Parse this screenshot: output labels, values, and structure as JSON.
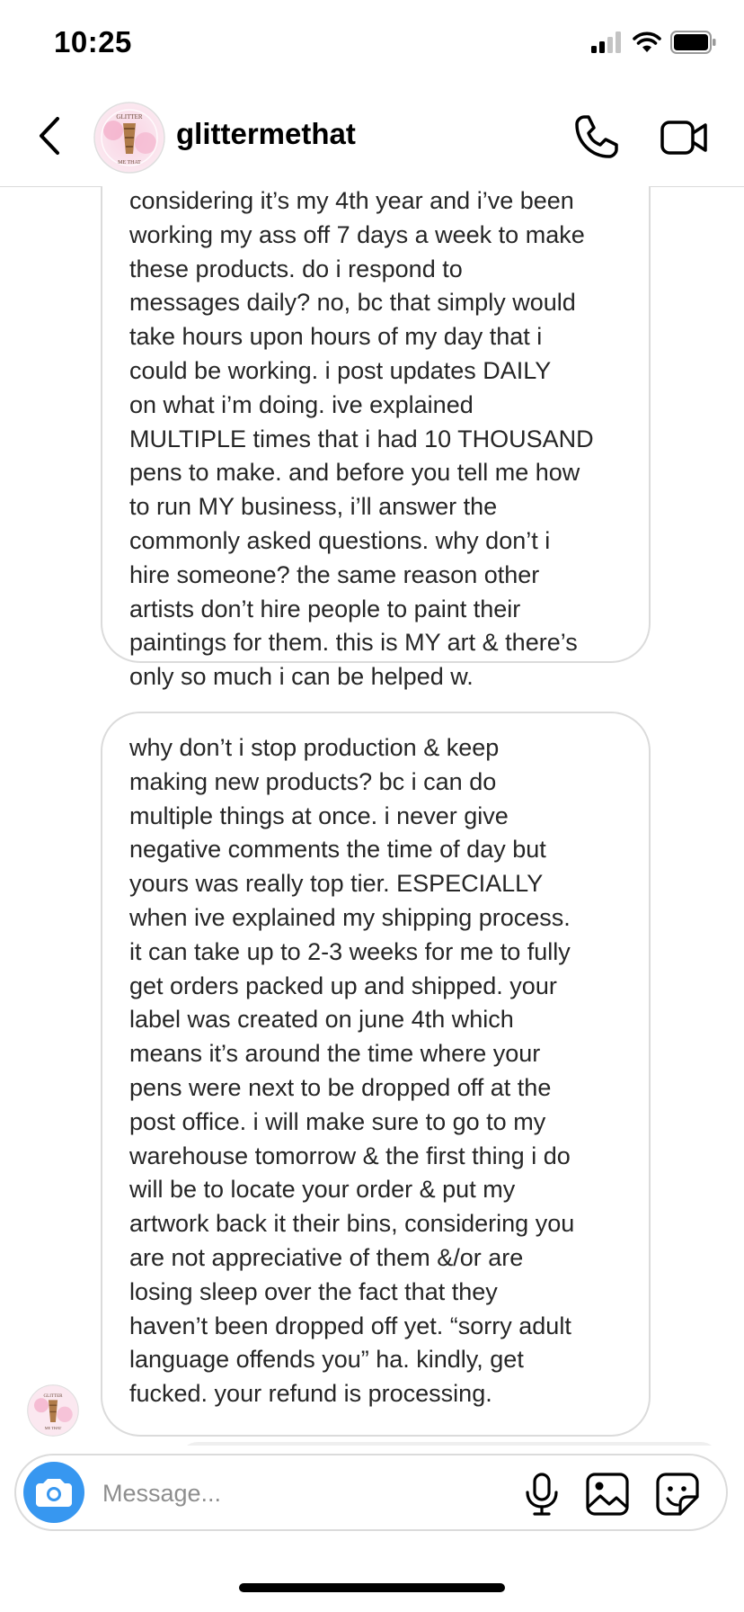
{
  "status_bar": {
    "time": "10:25"
  },
  "header": {
    "username": "glittermethat",
    "avatar_text_top": "GLITTER",
    "avatar_text_bottom": "ME THAT"
  },
  "messages": [
    {
      "lines": [
        "considering it’s my 4th year and i’ve been",
        "working my ass off 7 days a week to make",
        "these products. do i respond to",
        "messages daily? no, bc that simply would",
        "take hours upon hours of my day that i",
        "could be working. i post updates DAILY",
        "on what i’m doing. ive explained",
        "MULTIPLE times that i had 10 THOUSAND",
        "pens to make. and before you tell me how",
        "to run MY business, i’ll answer the",
        "commonly asked questions. why don’t i",
        "hire someone? the same reason other",
        "artists don’t hire people to paint their",
        "paintings for them. this is MY art & there’s",
        "only so much i can be helped w."
      ]
    },
    {
      "lines": [
        "why don’t i stop production & keep",
        "making new products? bc i can do",
        "multiple things at once. i never give",
        "negative comments the time of day but",
        "yours was really top tier. ESPECIALLY",
        "when ive explained my shipping process.",
        "it can take up to 2-3 weeks for me to fully",
        "get orders packed up and shipped. your",
        "label was created on june 4th which",
        "means it’s around the time where your",
        "pens were next to be dropped off at the",
        "post office. i will make sure to go to my",
        "warehouse tomorrow & the first thing i do",
        "will be to locate your order & put my",
        "artwork back it their bins, considering you",
        "are not appreciative of them &/or are",
        "losing sleep over the fact that they",
        "haven’t been dropped off yet. “sorry adult",
        "language offends you” ha. kindly, get",
        "fucked. your refund is processing."
      ]
    }
  ],
  "composer": {
    "placeholder": "Message..."
  },
  "icons": {
    "back": "chevron-left-icon",
    "call": "phone-icon",
    "video": "video-camera-icon",
    "camera": "camera-icon",
    "mic": "microphone-icon",
    "gallery": "image-icon",
    "sticker": "sticker-icon"
  },
  "colors": {
    "accent": "#3797f0",
    "bubble_border": "#dbdbdb",
    "text": "#262626",
    "placeholder": "#8e8e8e"
  }
}
